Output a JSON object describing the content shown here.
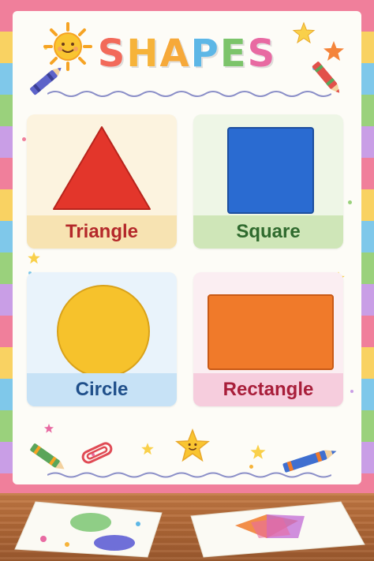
{
  "poster": {
    "title_letters": [
      "S",
      "H",
      "A",
      "P",
      "E",
      "S"
    ],
    "title_colors": [
      "#f26a5a",
      "#f6b33a",
      "#f6a93a",
      "#5db7e6",
      "#7cc46a",
      "#e86aa2"
    ]
  },
  "cards": [
    {
      "label": "Triangle",
      "shape": "triangle",
      "shape_color": "#e3362b",
      "bg": "#fcf3df",
      "band": "#f7e3b2",
      "label_color": "#b4282a"
    },
    {
      "label": "Square",
      "shape": "square",
      "shape_color": "#2a6bd1",
      "bg": "#eef6e6",
      "band": "#cfe6b8",
      "label_color": "#2f6a2e"
    },
    {
      "label": "Circle",
      "shape": "circle",
      "shape_color": "#f6c22c",
      "bg": "#e9f3fb",
      "band": "#c7e2f6",
      "label_color": "#1f4f8a"
    },
    {
      "label": "Rectangle",
      "shape": "rectangle",
      "shape_color": "#f07a2a",
      "bg": "#fbeef2",
      "band": "#f6cddd",
      "label_color": "#a81e3a"
    }
  ],
  "decorations": {
    "icons": [
      "sun-icon",
      "star-icon",
      "crayon-icon",
      "paperclip-icon"
    ]
  }
}
